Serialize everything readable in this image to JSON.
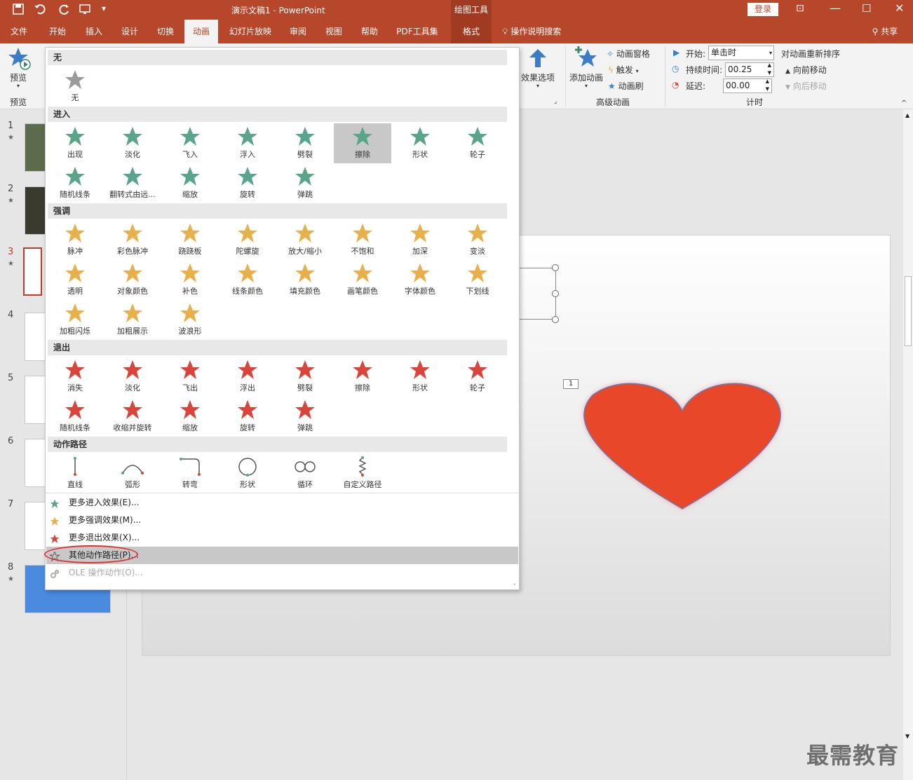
{
  "titlebar": {
    "doc_title": "演示文稿1 - PowerPoint",
    "context_group": "绘图工具",
    "login_button": "登录"
  },
  "tabs": [
    "文件",
    "开始",
    "插入",
    "设计",
    "切换",
    "动画",
    "幻灯片放映",
    "审阅",
    "视图",
    "帮助",
    "PDF工具集",
    "格式"
  ],
  "active_tab": "动画",
  "tellme": "操作说明搜索",
  "share": "共享",
  "ribbon": {
    "preview_label": "预览",
    "preview_group": "预览",
    "effect_options": "效果选项",
    "add_animation": "添加动画",
    "animation_pane": "动画窗格",
    "trigger": "触发",
    "animation_painter": "动画刷",
    "advanced_group": "高级动画",
    "start_label": "开始:",
    "start_value": "单击时",
    "duration_label": "持续时间:",
    "duration_value": "00.25",
    "delay_label": "延迟:",
    "delay_value": "00.00",
    "reorder_title": "对动画重新排序",
    "move_earlier": "向前移动",
    "move_later": "向后移动",
    "timing_group": "计时"
  },
  "gallery": {
    "sections": {
      "none": "无",
      "entrance": "进入",
      "emphasis": "强调",
      "exit": "退出",
      "motion": "动作路径"
    },
    "none_item": "无",
    "entrance": [
      "出现",
      "淡化",
      "飞入",
      "浮入",
      "劈裂",
      "擦除",
      "形状",
      "轮子",
      "随机线条",
      "翻转式由远...",
      "缩放",
      "旋转",
      "弹跳"
    ],
    "emphasis": [
      "脉冲",
      "彩色脉冲",
      "跷跷板",
      "陀螺旋",
      "放大/缩小",
      "不饱和",
      "加深",
      "变淡",
      "透明",
      "对象颜色",
      "补色",
      "线条颜色",
      "填充颜色",
      "画笔颜色",
      "字体颜色",
      "下划线",
      "加粗闪烁",
      "加粗展示",
      "波浪形"
    ],
    "exit": [
      "消失",
      "淡化",
      "飞出",
      "浮出",
      "劈裂",
      "擦除",
      "形状",
      "轮子",
      "随机线条",
      "收缩并旋转",
      "缩放",
      "旋转",
      "弹跳"
    ],
    "motion": [
      "直线",
      "弧形",
      "转弯",
      "形状",
      "循环",
      "自定义路径"
    ],
    "highlighted_entrance": "擦除",
    "menu": [
      {
        "label": "更多进入效果(E)...",
        "icon": "green-star-icon",
        "enabled": true
      },
      {
        "label": "更多强调效果(M)...",
        "icon": "gold-star-icon",
        "enabled": true
      },
      {
        "label": "更多退出效果(X)...",
        "icon": "red-star-icon",
        "enabled": true
      },
      {
        "label": "其他动作路径(P)...",
        "icon": "outline-star-icon",
        "enabled": true,
        "highlighted": true
      },
      {
        "label": "OLE 操作动作(O)...",
        "icon": "ole-action-icon",
        "enabled": false
      }
    ]
  },
  "thumbnails": [
    {
      "num": "1",
      "star": "★"
    },
    {
      "num": "2",
      "star": "★"
    },
    {
      "num": "3",
      "star": "★",
      "selected": true
    },
    {
      "num": "4",
      "star": ""
    },
    {
      "num": "5",
      "star": ""
    },
    {
      "num": "6",
      "star": ""
    },
    {
      "num": "7",
      "star": ""
    },
    {
      "num": "8",
      "star": "★"
    }
  ],
  "slide": {
    "animation_tag": "1"
  },
  "watermark": "最需教育",
  "colors": {
    "accent": "#b7472a",
    "entrance": "#5aa58a",
    "emphasis": "#e8b04a",
    "exit": "#d9453a",
    "heart": "#e8472a"
  }
}
